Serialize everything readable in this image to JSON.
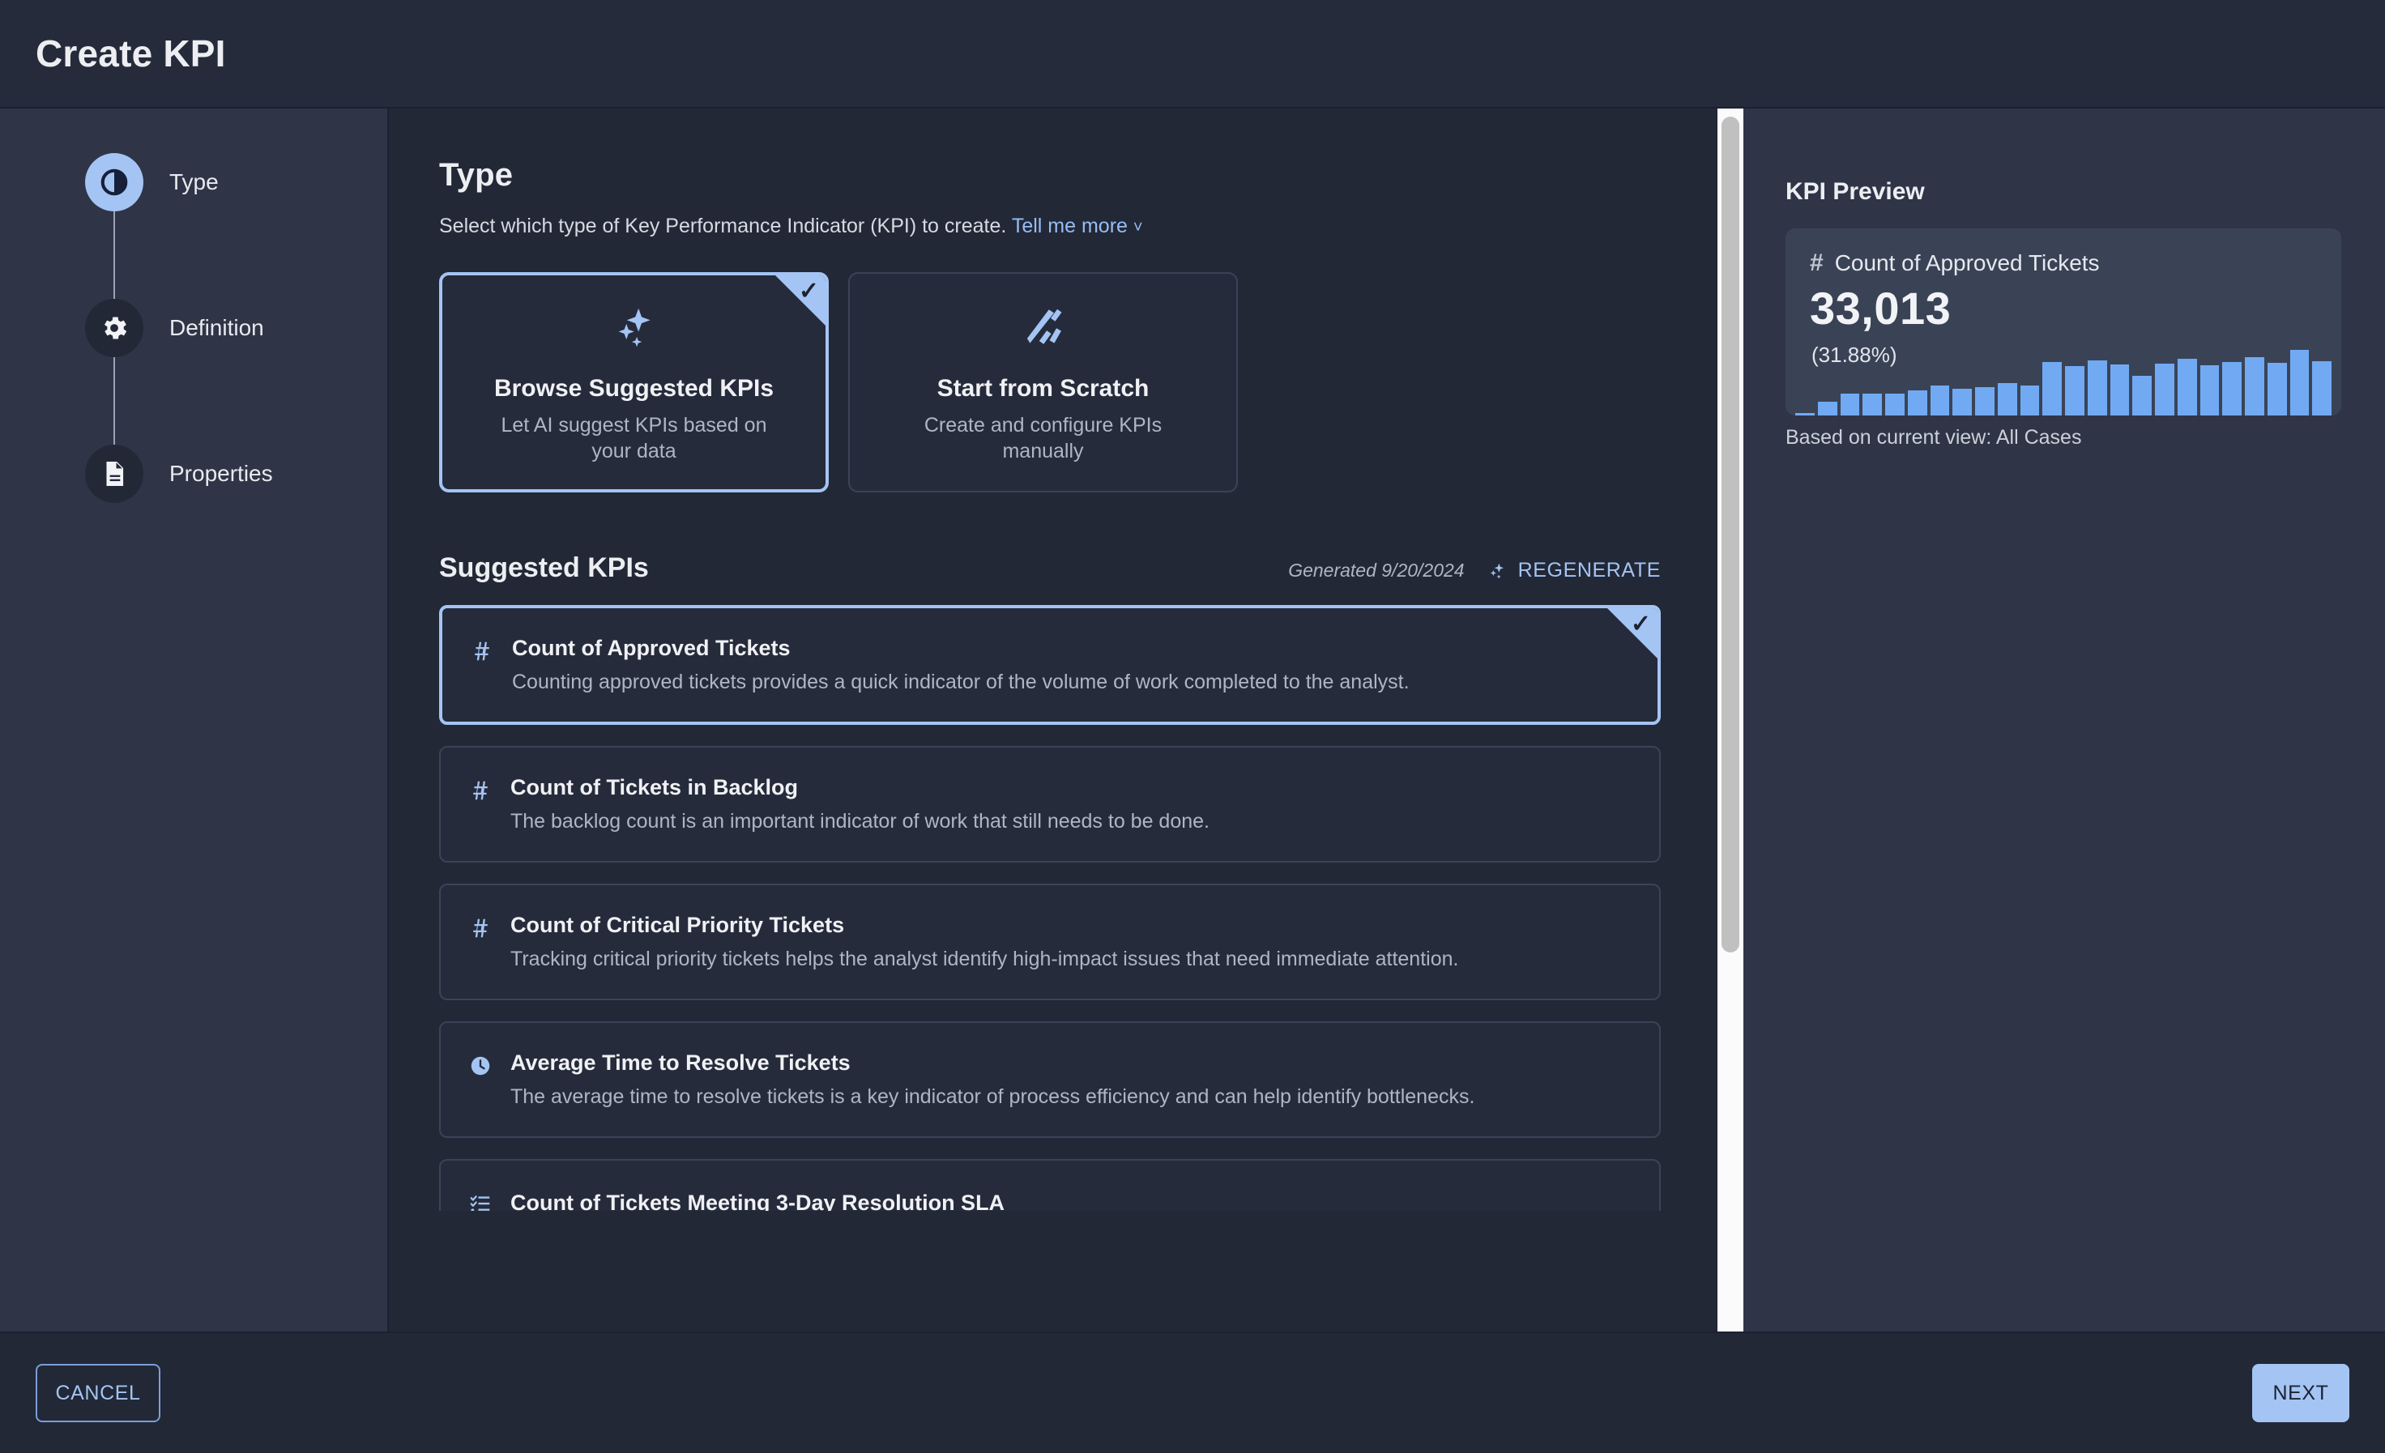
{
  "header": {
    "title": "Create KPI"
  },
  "stepper": {
    "items": [
      {
        "label": "Type",
        "icon": "contrast-icon",
        "active": true
      },
      {
        "label": "Definition",
        "icon": "gear-icon",
        "active": false
      },
      {
        "label": "Properties",
        "icon": "document-icon",
        "active": false
      }
    ]
  },
  "type_section": {
    "title": "Type",
    "description": "Select which type of Key Performance Indicator (KPI) to create.",
    "link_label": "Tell me more",
    "chevron": "chevron-down-icon",
    "cards": [
      {
        "name": "Browse Suggested KPIs",
        "description": "Let AI suggest KPIs based on your data",
        "icon": "sparkles-icon",
        "selected": true
      },
      {
        "name": "Start from Scratch",
        "description": "Create and configure KPIs manually",
        "icon": "wand-pencil-icon",
        "selected": false
      }
    ]
  },
  "suggested": {
    "title": "Suggested KPIs",
    "generated_label": "Generated 9/20/2024",
    "regenerate_label": "REGENERATE",
    "regenerate_icon": "sparkles-icon",
    "items": [
      {
        "name": "Count of Approved Tickets",
        "description": "Counting approved tickets provides a quick indicator of the volume of work completed to the analyst.",
        "icon": "hash-icon",
        "selected": true
      },
      {
        "name": "Count of Tickets in Backlog",
        "description": "The backlog count is an important indicator of work that still needs to be done.",
        "icon": "hash-icon",
        "selected": false
      },
      {
        "name": "Count of Critical Priority Tickets",
        "description": "Tracking critical priority tickets helps the analyst identify high-impact issues that need immediate attention.",
        "icon": "hash-icon",
        "selected": false
      },
      {
        "name": "Average Time to Resolve Tickets",
        "description": "The average time to resolve tickets is a key indicator of process efficiency and can help identify bottlenecks.",
        "icon": "clock-icon",
        "selected": false
      },
      {
        "name": "Count of Tickets Meeting 3-Day Resolution SLA",
        "description": "",
        "icon": "checklist-icon",
        "selected": false
      }
    ]
  },
  "preview": {
    "title": "KPI Preview",
    "kpi_icon": "hash-icon",
    "kpi_name": "Count of Approved Tickets",
    "value": "33,013",
    "percent": "(31.88%)",
    "footnote": "Based on current view: All Cases"
  },
  "chart_data": {
    "type": "bar",
    "title": "Count of Approved Tickets",
    "xlabel": "",
    "ylabel": "",
    "grid": false,
    "legend": "none",
    "ylim": [
      0,
      100
    ],
    "categories": [
      "1",
      "2",
      "3",
      "4",
      "5",
      "6",
      "7",
      "8",
      "9",
      "10",
      "11",
      "12",
      "13",
      "14",
      "15",
      "16",
      "17",
      "18",
      "19",
      "20",
      "21",
      "22",
      "23",
      "24"
    ],
    "values": [
      4,
      20,
      31,
      31,
      31,
      36,
      43,
      38,
      41,
      47,
      43,
      77,
      71,
      79,
      73,
      57,
      74,
      81,
      72,
      77,
      84,
      76,
      94,
      78
    ]
  },
  "scrollbar": {
    "name": "main-scrollbar"
  },
  "footer": {
    "cancel_label": "CANCEL",
    "next_label": "NEXT"
  },
  "colors": {
    "accent": "#a4c4f4",
    "bar": "#71aaf3",
    "page_bg": "#222836",
    "panel_bg": "#2f3547",
    "card_bg": "#252b3a",
    "preview_card_bg": "#3a4356"
  }
}
